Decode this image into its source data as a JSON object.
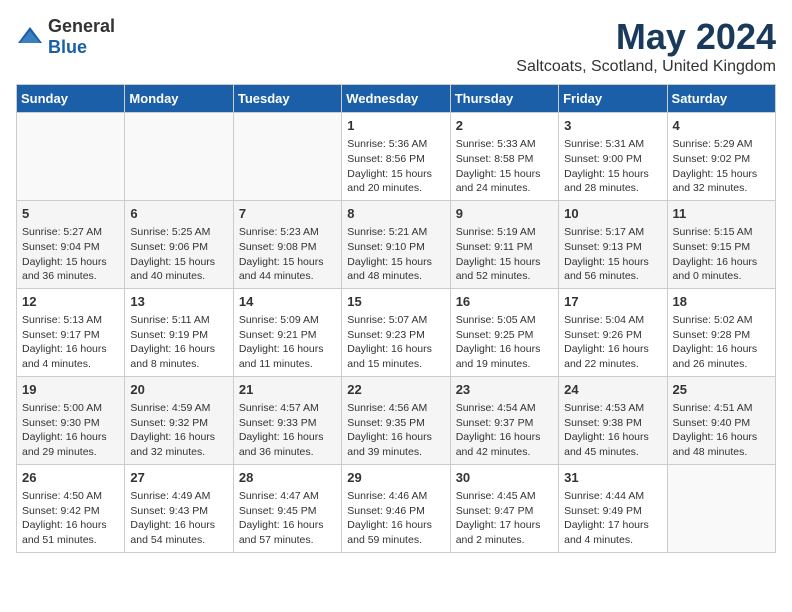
{
  "header": {
    "logo_general": "General",
    "logo_blue": "Blue",
    "title": "May 2024",
    "subtitle": "Saltcoats, Scotland, United Kingdom"
  },
  "calendar": {
    "days_of_week": [
      "Sunday",
      "Monday",
      "Tuesday",
      "Wednesday",
      "Thursday",
      "Friday",
      "Saturday"
    ],
    "weeks": [
      [
        {
          "day": "",
          "info": ""
        },
        {
          "day": "",
          "info": ""
        },
        {
          "day": "",
          "info": ""
        },
        {
          "day": "1",
          "info": "Sunrise: 5:36 AM\nSunset: 8:56 PM\nDaylight: 15 hours\nand 20 minutes."
        },
        {
          "day": "2",
          "info": "Sunrise: 5:33 AM\nSunset: 8:58 PM\nDaylight: 15 hours\nand 24 minutes."
        },
        {
          "day": "3",
          "info": "Sunrise: 5:31 AM\nSunset: 9:00 PM\nDaylight: 15 hours\nand 28 minutes."
        },
        {
          "day": "4",
          "info": "Sunrise: 5:29 AM\nSunset: 9:02 PM\nDaylight: 15 hours\nand 32 minutes."
        }
      ],
      [
        {
          "day": "5",
          "info": "Sunrise: 5:27 AM\nSunset: 9:04 PM\nDaylight: 15 hours\nand 36 minutes."
        },
        {
          "day": "6",
          "info": "Sunrise: 5:25 AM\nSunset: 9:06 PM\nDaylight: 15 hours\nand 40 minutes."
        },
        {
          "day": "7",
          "info": "Sunrise: 5:23 AM\nSunset: 9:08 PM\nDaylight: 15 hours\nand 44 minutes."
        },
        {
          "day": "8",
          "info": "Sunrise: 5:21 AM\nSunset: 9:10 PM\nDaylight: 15 hours\nand 48 minutes."
        },
        {
          "day": "9",
          "info": "Sunrise: 5:19 AM\nSunset: 9:11 PM\nDaylight: 15 hours\nand 52 minutes."
        },
        {
          "day": "10",
          "info": "Sunrise: 5:17 AM\nSunset: 9:13 PM\nDaylight: 15 hours\nand 56 minutes."
        },
        {
          "day": "11",
          "info": "Sunrise: 5:15 AM\nSunset: 9:15 PM\nDaylight: 16 hours\nand 0 minutes."
        }
      ],
      [
        {
          "day": "12",
          "info": "Sunrise: 5:13 AM\nSunset: 9:17 PM\nDaylight: 16 hours\nand 4 minutes."
        },
        {
          "day": "13",
          "info": "Sunrise: 5:11 AM\nSunset: 9:19 PM\nDaylight: 16 hours\nand 8 minutes."
        },
        {
          "day": "14",
          "info": "Sunrise: 5:09 AM\nSunset: 9:21 PM\nDaylight: 16 hours\nand 11 minutes."
        },
        {
          "day": "15",
          "info": "Sunrise: 5:07 AM\nSunset: 9:23 PM\nDaylight: 16 hours\nand 15 minutes."
        },
        {
          "day": "16",
          "info": "Sunrise: 5:05 AM\nSunset: 9:25 PM\nDaylight: 16 hours\nand 19 minutes."
        },
        {
          "day": "17",
          "info": "Sunrise: 5:04 AM\nSunset: 9:26 PM\nDaylight: 16 hours\nand 22 minutes."
        },
        {
          "day": "18",
          "info": "Sunrise: 5:02 AM\nSunset: 9:28 PM\nDaylight: 16 hours\nand 26 minutes."
        }
      ],
      [
        {
          "day": "19",
          "info": "Sunrise: 5:00 AM\nSunset: 9:30 PM\nDaylight: 16 hours\nand 29 minutes."
        },
        {
          "day": "20",
          "info": "Sunrise: 4:59 AM\nSunset: 9:32 PM\nDaylight: 16 hours\nand 32 minutes."
        },
        {
          "day": "21",
          "info": "Sunrise: 4:57 AM\nSunset: 9:33 PM\nDaylight: 16 hours\nand 36 minutes."
        },
        {
          "day": "22",
          "info": "Sunrise: 4:56 AM\nSunset: 9:35 PM\nDaylight: 16 hours\nand 39 minutes."
        },
        {
          "day": "23",
          "info": "Sunrise: 4:54 AM\nSunset: 9:37 PM\nDaylight: 16 hours\nand 42 minutes."
        },
        {
          "day": "24",
          "info": "Sunrise: 4:53 AM\nSunset: 9:38 PM\nDaylight: 16 hours\nand 45 minutes."
        },
        {
          "day": "25",
          "info": "Sunrise: 4:51 AM\nSunset: 9:40 PM\nDaylight: 16 hours\nand 48 minutes."
        }
      ],
      [
        {
          "day": "26",
          "info": "Sunrise: 4:50 AM\nSunset: 9:42 PM\nDaylight: 16 hours\nand 51 minutes."
        },
        {
          "day": "27",
          "info": "Sunrise: 4:49 AM\nSunset: 9:43 PM\nDaylight: 16 hours\nand 54 minutes."
        },
        {
          "day": "28",
          "info": "Sunrise: 4:47 AM\nSunset: 9:45 PM\nDaylight: 16 hours\nand 57 minutes."
        },
        {
          "day": "29",
          "info": "Sunrise: 4:46 AM\nSunset: 9:46 PM\nDaylight: 16 hours\nand 59 minutes."
        },
        {
          "day": "30",
          "info": "Sunrise: 4:45 AM\nSunset: 9:47 PM\nDaylight: 17 hours\nand 2 minutes."
        },
        {
          "day": "31",
          "info": "Sunrise: 4:44 AM\nSunset: 9:49 PM\nDaylight: 17 hours\nand 4 minutes."
        },
        {
          "day": "",
          "info": ""
        }
      ]
    ]
  }
}
